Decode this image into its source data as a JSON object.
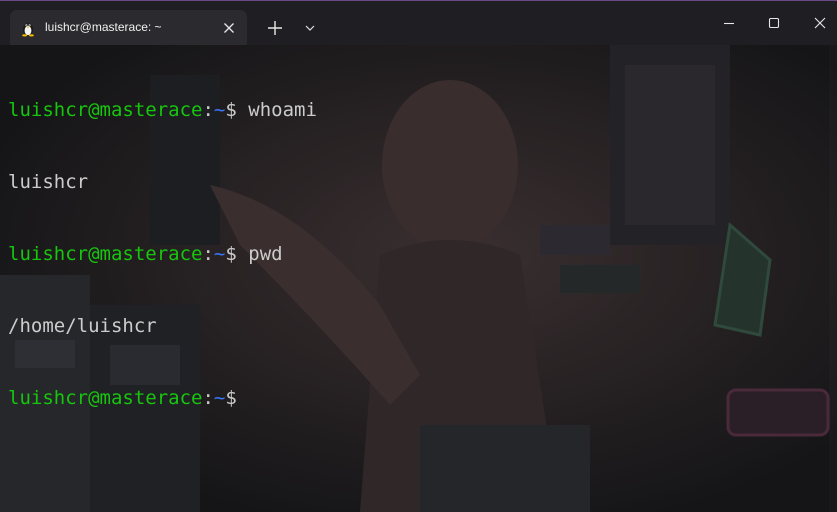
{
  "window": {
    "accent_color": "#6a4a86"
  },
  "tab": {
    "title": "luishcr@masterace: ~",
    "icon": "linux-penguin-icon"
  },
  "titlebar": {
    "new_tab_icon": "plus-icon",
    "dropdown_icon": "chevron-down-icon",
    "minimize_icon": "minimize-icon",
    "maximize_icon": "maximize-icon",
    "close_icon": "close-icon"
  },
  "terminal": {
    "colors": {
      "user_host": "#16c60c",
      "path": "#3b78ff",
      "text": "#cccccc"
    },
    "lines": [
      {
        "user_host": "luishcr@masterace",
        "colon": ":",
        "path": "~",
        "dollar": "$",
        "command": " whoami"
      },
      {
        "output": "luishcr"
      },
      {
        "user_host": "luishcr@masterace",
        "colon": ":",
        "path": "~",
        "dollar": "$",
        "command": " pwd"
      },
      {
        "output": "/home/luishcr"
      },
      {
        "user_host": "luishcr@masterace",
        "colon": ":",
        "path": "~",
        "dollar": "$",
        "command": ""
      }
    ]
  }
}
